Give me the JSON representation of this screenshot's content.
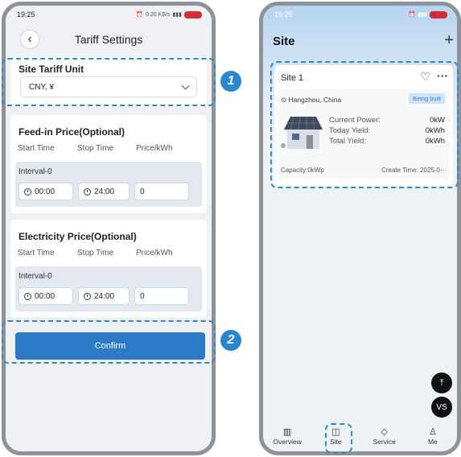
{
  "left": {
    "status_time": "19:25",
    "status_speed": "0.20 KB/s",
    "title": "Tariff Settings",
    "tariff_unit": {
      "label": "Site Tariff Unit",
      "value": "CNY, ¥"
    },
    "feed_in": {
      "title": "Feed-in Price(Optional)",
      "col_start": "Start Time",
      "col_stop": "Stop Time",
      "col_price": "Price/kWh",
      "interval_label": "Interval-0",
      "start": "00:00",
      "stop": "24:00",
      "price": "0"
    },
    "electricity": {
      "title": "Electricity Price(Optional)",
      "col_start": "Start Time",
      "col_stop": "Stop Time",
      "col_price": "Price/kWh",
      "interval_label": "Interval-0",
      "start": "00:00",
      "stop": "24:00",
      "price": "0"
    },
    "confirm_label": "Confirm"
  },
  "callouts": {
    "one": "1",
    "two": "2",
    "color": "#2b86d0"
  },
  "right": {
    "status_time": "19:25",
    "title": "Site",
    "add": "+",
    "site": {
      "name": "Site 1",
      "location": "Hangzhou, China",
      "status": "Being built",
      "current_power_label": "Current Power:",
      "current_power": "0kW",
      "today_yield_label": "Today Yield:",
      "today_yield": "0kWh",
      "total_yield_label": "Total Yield:",
      "total_yield": "0kWh",
      "capacity": "Capacity:0kWp",
      "create_time": "Create Time: 2025-0···"
    },
    "fab_top": "⤒",
    "fab_vs": "VS",
    "tabs": [
      {
        "label": "Overview",
        "icon": "chart-icon"
      },
      {
        "label": "Site",
        "icon": "site-icon"
      },
      {
        "label": "Service",
        "icon": "service-icon"
      },
      {
        "label": "Me",
        "icon": "person-icon"
      }
    ]
  },
  "colors": {
    "accent": "#2d7bc7",
    "dash": "#2e87c9",
    "battery": "#d12d3b"
  }
}
